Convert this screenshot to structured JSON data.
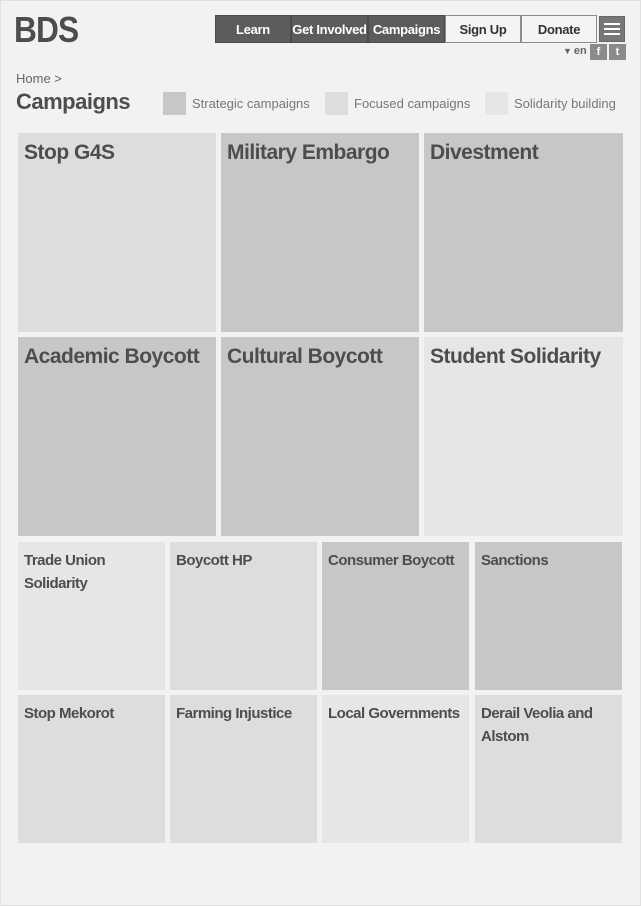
{
  "header": {
    "logo": "BDS",
    "nav": [
      "Learn",
      "Get Involved",
      "Campaigns",
      "Sign Up",
      "Donate"
    ],
    "language": "en",
    "social": [
      "f",
      "t"
    ]
  },
  "breadcrumb": "Home >",
  "page_title": "Campaigns",
  "legend": [
    {
      "label": "Strategic campaigns",
      "color": "#c6c7c9"
    },
    {
      "label": "Focused campaigns",
      "color": "#dcdddf"
    },
    {
      "label": "Solidarity building",
      "color": "#e6e6e6"
    }
  ],
  "campaigns_large": [
    {
      "title": "Stop G4S",
      "type": "focused"
    },
    {
      "title": "Military Embargo",
      "type": "strategic"
    },
    {
      "title": "Divestment",
      "type": "strategic"
    },
    {
      "title": "Academic Boycott",
      "type": "strategic"
    },
    {
      "title": "Cultural Boycott",
      "type": "strategic"
    },
    {
      "title": "Student Solidarity",
      "type": "solidarity"
    }
  ],
  "campaigns_small": [
    {
      "title": "Trade Union Solidarity",
      "type": "solidarity"
    },
    {
      "title": "Boycott HP",
      "type": "focused"
    },
    {
      "title": "Consumer Boycott",
      "type": "strategic"
    },
    {
      "title": "Sanctions",
      "type": "strategic"
    },
    {
      "title": "Stop Mekorot",
      "type": "focused"
    },
    {
      "title": "Farming Injustice",
      "type": "focused"
    },
    {
      "title": "Local Governments",
      "type": "solidarity"
    },
    {
      "title": "Derail Veolia and Alstom",
      "type": "focused"
    }
  ]
}
